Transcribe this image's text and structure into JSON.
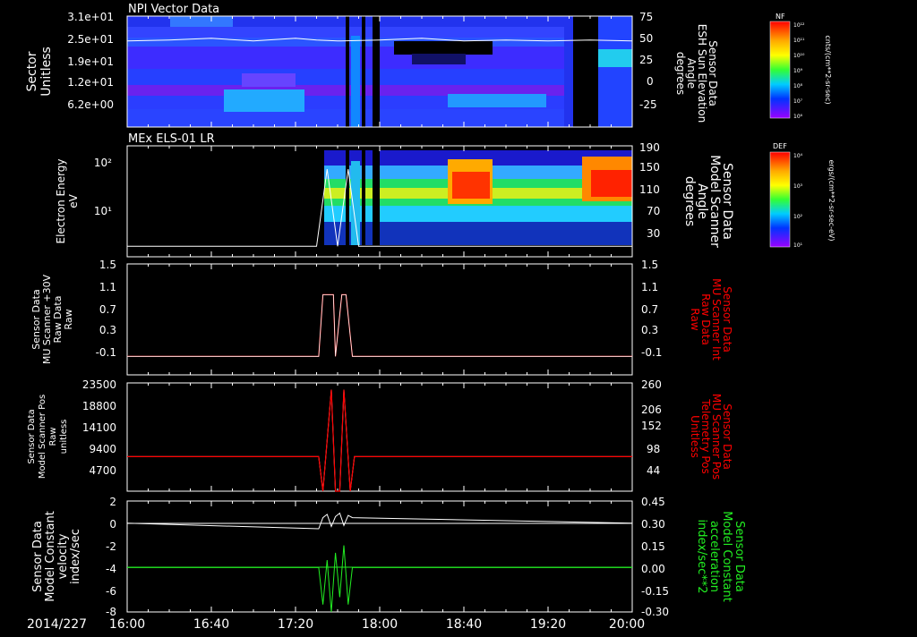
{
  "date_label": "2014/227",
  "time_ticks": [
    "16:00",
    "16:40",
    "17:20",
    "18:00",
    "18:40",
    "19:20",
    "20:00"
  ],
  "colors": {
    "background": "#000000",
    "axis": "#ffffff",
    "red_trace": "#ff0000",
    "green_trace": "#22ee22",
    "white_trace": "#ffffff"
  },
  "panels": {
    "npi": {
      "title": "NPI Vector Data",
      "ylabel_left": [
        "Sector",
        "Unitless"
      ],
      "ylabel_right": [
        "Sensor Data",
        "ESH Sun Elevation",
        "Angle",
        "degrees"
      ],
      "left_ticks": [
        "3.1e+01",
        "2.5e+01",
        "1.9e+01",
        "1.2e+01",
        "6.2e+00"
      ],
      "right_ticks": [
        "75",
        "50",
        "25",
        "0",
        "-25"
      ],
      "colorbar_label": "NF",
      "colorbar_ticks": [
        "10¹²",
        "10¹¹",
        "10¹⁰",
        "10⁹",
        "10⁸",
        "10⁷",
        "10⁶"
      ],
      "colorbar_units": "cnts/(cm**2-sr-sec)"
    },
    "els": {
      "title": "MEx ELS-01 LR",
      "ylabel_left": [
        "Electron Energy",
        "eV"
      ],
      "ylabel_right": [
        "Sensor Data",
        "Model Scanner",
        "Angle",
        "degrees"
      ],
      "left_ticks": [
        "10²",
        "10¹"
      ],
      "right_ticks": [
        "190",
        "150",
        "110",
        "70",
        "30"
      ],
      "colorbar_label": "DEF",
      "colorbar_ticks": [
        "10⁴",
        "10³",
        "10²",
        "10¹"
      ],
      "colorbar_units": "ergs/(cm**2-sr-sec-eV)"
    },
    "mu_raw": {
      "ylabel_left": [
        "Sensor Data",
        "MU Scanner +30V",
        "Raw Data",
        "Raw"
      ],
      "ylabel_right": [
        "Sensor Data",
        "MU Scanner Int",
        "Raw Data",
        "Raw"
      ],
      "left_ticks": [
        "1.5",
        "1.1",
        "0.7",
        "0.3",
        "-0.1"
      ],
      "right_ticks": [
        "1.5",
        "1.1",
        "0.7",
        "0.3",
        "-0.1"
      ]
    },
    "scanner_pos": {
      "ylabel_left": [
        "Sensor Data",
        "Model Scanner Pos",
        "Raw",
        "unitless"
      ],
      "ylabel_right": [
        "Sensor Data",
        "MU Scanner Pos",
        "Telemetry Pos",
        "Unitless"
      ],
      "left_ticks": [
        "23500",
        "18800",
        "14100",
        "9400",
        "4700"
      ],
      "right_ticks": [
        "260",
        "206",
        "152",
        "98",
        "44"
      ]
    },
    "velocity": {
      "ylabel_left": [
        "Sensor Data",
        "Model Constant",
        "velocity",
        "index/sec"
      ],
      "ylabel_right": [
        "Sensor Data",
        "Model Constant",
        "acceleration",
        "index/sec**2"
      ],
      "left_ticks": [
        "2",
        "0",
        "-2",
        "-4",
        "-6",
        "-8"
      ],
      "right_ticks": [
        "0.45",
        "0.30",
        "0.15",
        "0.00",
        "-0.15",
        "-0.30"
      ]
    }
  },
  "chart_data": [
    {
      "type": "heatmap",
      "title": "NPI Vector Data",
      "x_range": [
        "16:00",
        "20:00"
      ],
      "y_range": [
        0,
        31
      ],
      "ylabel": "Sector Unitless",
      "overlay_series": {
        "name": "Sensor Data ESH Sun Elevation Angle",
        "x_min": [
          0,
          20,
          40,
          60,
          80,
          90,
          100,
          120,
          140,
          160,
          180,
          200,
          220,
          240
        ],
        "y": [
          47,
          48,
          50,
          47,
          50,
          48,
          47,
          48,
          50,
          47,
          48,
          47,
          48,
          47
        ]
      }
    },
    {
      "type": "heatmap",
      "title": "MEx ELS-01 LR",
      "x_range": [
        "16:00",
        "20:00"
      ],
      "ylabel": "Electron Energy eV",
      "overlay_series": {
        "name": "Sensor Data Model Scanner Angle",
        "x_min": [
          0,
          90,
          95,
          100,
          105,
          110,
          120,
          240
        ],
        "y": [
          18,
          18,
          150,
          18,
          150,
          18,
          18,
          18
        ]
      }
    },
    {
      "type": "line",
      "x_min": [
        0,
        91,
        93,
        98,
        99,
        102,
        104,
        107,
        109,
        240
      ],
      "series": [
        {
          "name": "MU Scanner +30V Raw",
          "values": [
            0,
            0,
            1,
            1,
            0,
            1,
            1,
            0,
            0,
            0
          ]
        }
      ],
      "ylim": [
        -0.3,
        1.5
      ]
    },
    {
      "type": "line",
      "x_min": [
        0,
        91,
        93,
        97,
        99,
        101,
        103,
        106,
        108,
        240
      ],
      "series": [
        {
          "name": "Model Scanner Pos Raw",
          "values": [
            7500,
            7500,
            0,
            22000,
            0,
            0,
            22000,
            0,
            7500,
            7500
          ]
        }
      ],
      "ylim": [
        0,
        23500
      ]
    },
    {
      "type": "line",
      "x_min": [
        0,
        91,
        93,
        95,
        97,
        99,
        101,
        103,
        105,
        107,
        240
      ],
      "series": [
        {
          "name": "Model Constant velocity",
          "values": [
            0,
            -0.5,
            0.5,
            0.8,
            -0.3,
            0.6,
            0.9,
            -0.2,
            0.7,
            0.5,
            0
          ]
        },
        {
          "name": "Model Constant acceleration",
          "values": [
            0,
            0,
            -0.25,
            0.05,
            -0.3,
            0.1,
            -0.2,
            0.15,
            -0.25,
            0,
            0
          ]
        }
      ],
      "ylim": [
        -8,
        2
      ]
    }
  ]
}
